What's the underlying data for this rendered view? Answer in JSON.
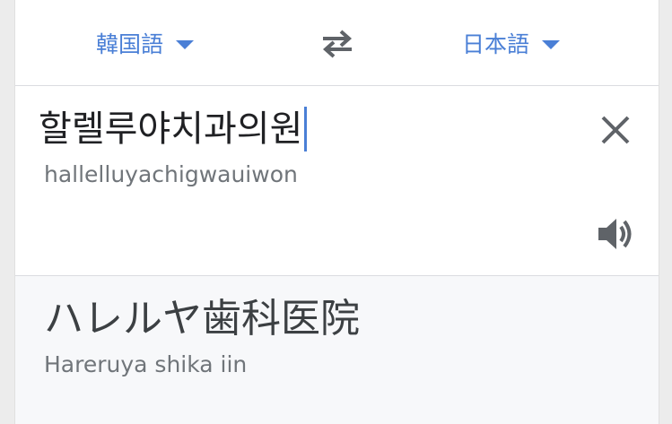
{
  "languages": {
    "source": "韓国語",
    "target": "日本語"
  },
  "input": {
    "text": "할렐루야치과의원",
    "transliteration": "hallelluyachigwauiwon"
  },
  "output": {
    "text": "ハレルヤ歯科医院",
    "transliteration": "Hareruya shika iin"
  },
  "icons": {
    "swap": "swap-arrows-icon",
    "clear": "close-icon",
    "speaker": "speaker-icon",
    "dropdown": "chevron-down-icon"
  },
  "colors": {
    "accent": "#4a7fd6",
    "output_background": "#f7f8fa"
  }
}
